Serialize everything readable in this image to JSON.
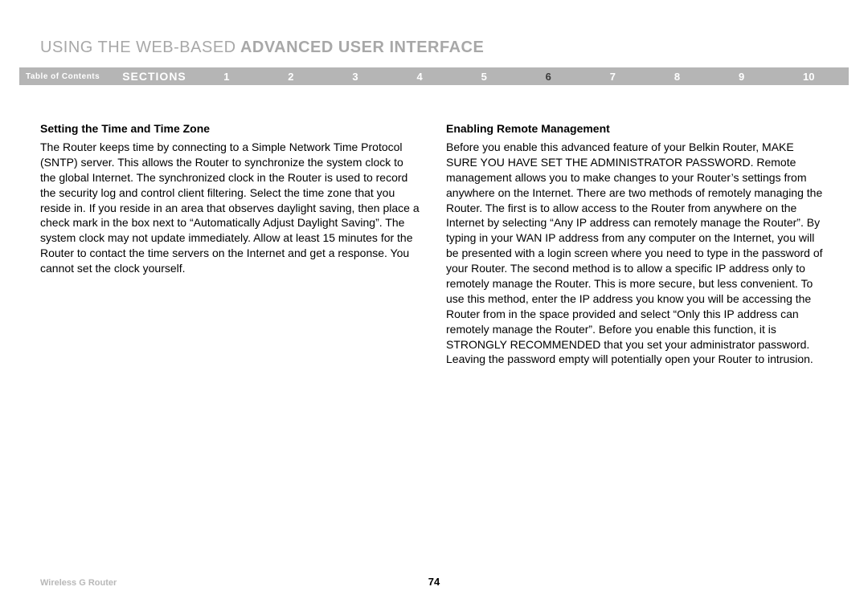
{
  "header": {
    "title_prefix": "USING THE WEB-BASED",
    "title_suffix": " ADVANCED USER INTERFACE"
  },
  "nav": {
    "toc_label": "Table of Contents",
    "sections_label": "SECTIONS",
    "items": [
      "1",
      "2",
      "3",
      "4",
      "5",
      "6",
      "7",
      "8",
      "9",
      "10"
    ],
    "active_index": 5
  },
  "columns": {
    "left": {
      "heading": "Setting the Time and Time Zone",
      "body": "The Router keeps time by connecting to a Simple Network Time Protocol (SNTP) server. This allows the Router to synchronize the system clock to the global Internet. The synchronized clock in the Router is used to record the security log and control client filtering. Select the time zone that you reside in. If you reside in an area that observes daylight saving, then place a check mark in the box next to “Automatically Adjust Daylight Saving”. The system clock may not update immediately. Allow at least 15 minutes for the Router to contact the time servers on the Internet and get a response. You cannot set the clock yourself."
    },
    "right": {
      "heading": "Enabling Remote Management",
      "body": "Before you enable this advanced feature of your Belkin Router, MAKE SURE YOU HAVE SET THE ADMINISTRATOR PASSWORD. Remote management allows you to make changes to your Router’s settings from anywhere on the Internet. There are two methods of remotely managing the Router. The first is to allow access to the Router from anywhere on the Internet by selecting “Any IP address can remotely manage the Router”. By typing in your WAN IP address from any computer on the Internet, you will be presented with a login screen where you need to type in the password of your Router. The second method is to allow a specific IP address only to remotely manage the Router. This is more secure, but less convenient. To use this method, enter the IP address you know you will be accessing the Router from in the space provided and select “Only this IP address can remotely manage the Router”. Before you enable this function, it is STRONGLY RECOMMENDED that you set your administrator password. Leaving the password empty will potentially open your Router to intrusion."
    }
  },
  "footer": {
    "product": "Wireless G Router",
    "page_number": "74"
  }
}
